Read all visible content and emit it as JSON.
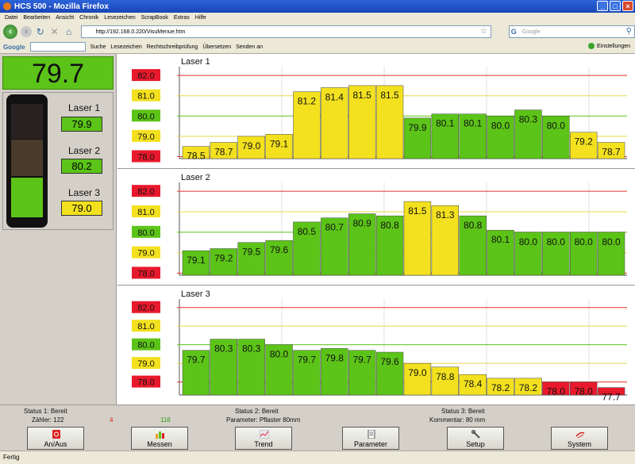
{
  "window": {
    "title": "HCS 500 - Mozilla Firefox"
  },
  "menu": [
    "Datei",
    "Bearbeiten",
    "Ansicht",
    "Chronik",
    "Lesezeichen",
    "ScrapBook",
    "Extras",
    "Hilfe"
  ],
  "nav": {
    "url": "http://192.168.0.220/VisuMenue.htm",
    "search_placeholder": "Google"
  },
  "google_toolbar": {
    "logo": "Google",
    "items": [
      "Suche",
      "Lesezeichen",
      "Rechtschreibprüfung",
      "Übersetzen",
      "Senden an"
    ],
    "settings": "Einstellungen"
  },
  "summary": {
    "big_value": "79.7",
    "lasers": [
      {
        "label": "Laser 1",
        "value": "79.9",
        "status": "green"
      },
      {
        "label": "Laser 2",
        "value": "80.2",
        "status": "green"
      },
      {
        "label": "Laser 3",
        "value": "79.0",
        "status": "yellow"
      }
    ]
  },
  "colors": {
    "green": "#5cc418",
    "yellow": "#f3e11f",
    "red": "#e8192c",
    "ref_red": "#e83030",
    "ref_yellow": "#e8d84a",
    "ref_green": "#5cc418"
  },
  "chart_data": [
    {
      "type": "bar",
      "title": "Laser 1",
      "y_labels": [
        "82.0",
        "81.0",
        "80.0",
        "79.0",
        "78.0"
      ],
      "ylim": [
        77.9,
        82.2
      ],
      "ref_lines": [
        82.0,
        81.0,
        80.0,
        79.0,
        78.0
      ],
      "values": [
        78.5,
        78.7,
        79.0,
        79.1,
        81.2,
        81.4,
        81.5,
        81.5,
        79.9,
        80.1,
        80.1,
        80.0,
        80.3,
        80.0,
        79.2,
        78.7
      ]
    },
    {
      "type": "bar",
      "title": "Laser 2",
      "y_labels": [
        "82.0",
        "81.0",
        "80.0",
        "79.0",
        "78.0"
      ],
      "ylim": [
        77.9,
        82.2
      ],
      "ref_lines": [
        82.0,
        81.0,
        80.0,
        79.0,
        78.0
      ],
      "values": [
        79.1,
        79.2,
        79.5,
        79.6,
        80.5,
        80.7,
        80.9,
        80.8,
        81.5,
        81.3,
        80.8,
        80.1,
        80.0,
        80.0,
        80.0,
        80.0
      ]
    },
    {
      "type": "bar",
      "title": "Laser 3",
      "y_labels": [
        "82.0",
        "81.0",
        "80.0",
        "79.0",
        "78.0"
      ],
      "ylim": [
        77.3,
        82.2
      ],
      "ref_lines": [
        82.0,
        81.0,
        80.0,
        79.0,
        78.0
      ],
      "values": [
        79.7,
        80.3,
        80.3,
        80.0,
        79.7,
        79.8,
        79.7,
        79.6,
        79.0,
        78.8,
        78.4,
        78.2,
        78.2,
        78.0,
        78.0,
        77.7
      ]
    }
  ],
  "status": {
    "s1_label": "Status 1:",
    "s1_value": "Bereit",
    "counter_label": "Zähler:",
    "counter_value": "122",
    "counter_red": "4",
    "counter_green": "118",
    "s2_label": "Status 2:",
    "s2_value": "Bereit",
    "param_label": "Parameter:",
    "param_value": "Pflaster 80mm",
    "s3_label": "Status 3:",
    "s3_value": "Bereit",
    "comment_label": "Kommentar:",
    "comment_value": "80 mm"
  },
  "buttons": [
    {
      "name": "an-aus-button",
      "label": "An/Aus",
      "icon": "power-icon"
    },
    {
      "name": "messen-button",
      "label": "Messen",
      "icon": "bar-chart-icon"
    },
    {
      "name": "trend-button",
      "label": "Trend",
      "icon": "trend-icon"
    },
    {
      "name": "parameter-button",
      "label": "Parameter",
      "icon": "document-icon"
    },
    {
      "name": "setup-button",
      "label": "Setup",
      "icon": "wrench-icon"
    },
    {
      "name": "system-button",
      "label": "System",
      "icon": "system-icon"
    }
  ],
  "browser_status": "Fertig"
}
